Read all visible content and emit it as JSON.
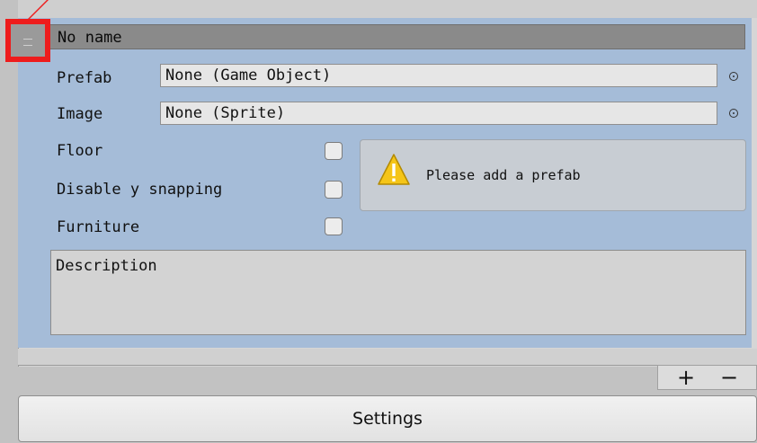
{
  "element": {
    "header": {
      "name": "No name"
    },
    "prefab": {
      "label": "Prefab",
      "value": "None (Game Object)"
    },
    "image": {
      "label": "Image",
      "value": "None (Sprite)"
    },
    "floor": {
      "label": "Floor",
      "checked": false
    },
    "disable_y_snapping": {
      "label": "Disable y snapping",
      "checked": false
    },
    "furniture": {
      "label": "Furniture",
      "checked": false
    },
    "help_box": {
      "type": "warning",
      "text": "Please add a prefab"
    },
    "description": {
      "value": "Description"
    }
  },
  "list_footer": {
    "add_label": "+",
    "remove_label": "−"
  },
  "settings_button": {
    "label": "Settings"
  },
  "icons": {
    "drag_handle": "drag-handle-icon",
    "object_picker": "object-picker-icon",
    "warning": "warning-icon"
  },
  "colors": {
    "element_background": "#a5bcd8",
    "highlight_annotation": "#ee1c1c",
    "warning_yellow": "#f5c518"
  }
}
